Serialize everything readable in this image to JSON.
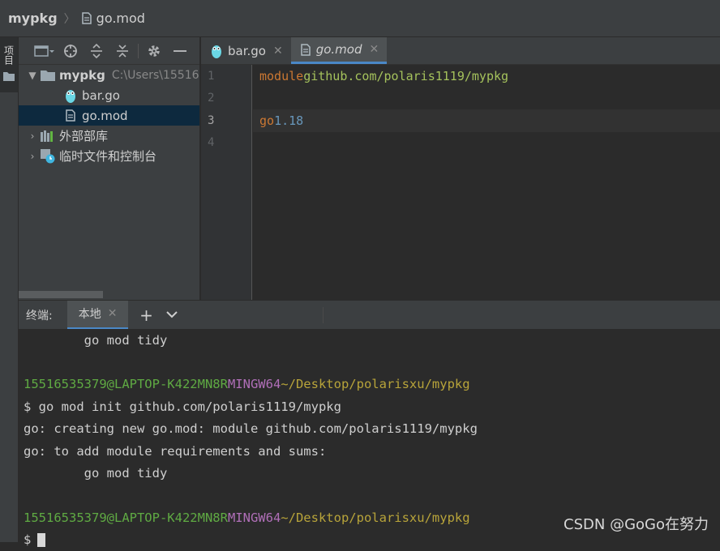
{
  "breadcrumb": {
    "project": "mypkg",
    "file": "go.mod"
  },
  "tool_strip": {
    "project_label": "项目"
  },
  "project_panel": {
    "tree": {
      "root": {
        "name": "mypkg",
        "path": "C:\\Users\\15516"
      },
      "files": [
        {
          "name": "bar.go",
          "icon": "gopher-icon"
        },
        {
          "name": "go.mod",
          "icon": "file-icon",
          "selected": true
        }
      ],
      "external_libraries": "外部部库",
      "scratches": "临时文件和控制台"
    }
  },
  "editor": {
    "tabs": [
      {
        "name": "bar.go",
        "icon": "gopher-icon",
        "active": false
      },
      {
        "name": "go.mod",
        "icon": "file-icon",
        "active": true
      }
    ],
    "line_numbers": [
      "1",
      "2",
      "3",
      "4"
    ],
    "code": {
      "line1_keyword": "module",
      "line1_value": "github.com/polaris1119/mypkg",
      "line3_keyword": "go",
      "line3_value": "1.18"
    }
  },
  "terminal": {
    "label": "终端:",
    "tab": "本地",
    "lines": {
      "l1": "        go mod tidy",
      "prompt_user": "15516535379@LAPTOP-K422MN8R",
      "prompt_env": "MINGW64",
      "prompt_path": "~/Desktop/polarisxu/mypkg",
      "l4": "$ go mod init github.com/polaris1119/mypkg",
      "l5": "go: creating new go.mod: module github.com/polaris1119/mypkg",
      "l6": "go: to add module requirements and sums:",
      "l7": "        go mod tidy",
      "last_prompt": "$"
    }
  },
  "watermark": "CSDN @GoGo在努力",
  "colors": {
    "keyword": "#cc7832",
    "string": "#a5c25c",
    "number": "#6897bb",
    "prompt_user": "#5faa43",
    "prompt_env": "#b06fb8",
    "prompt_path": "#b8a43a",
    "selection": "#0d293e",
    "tab_accent": "#4a88c7"
  }
}
